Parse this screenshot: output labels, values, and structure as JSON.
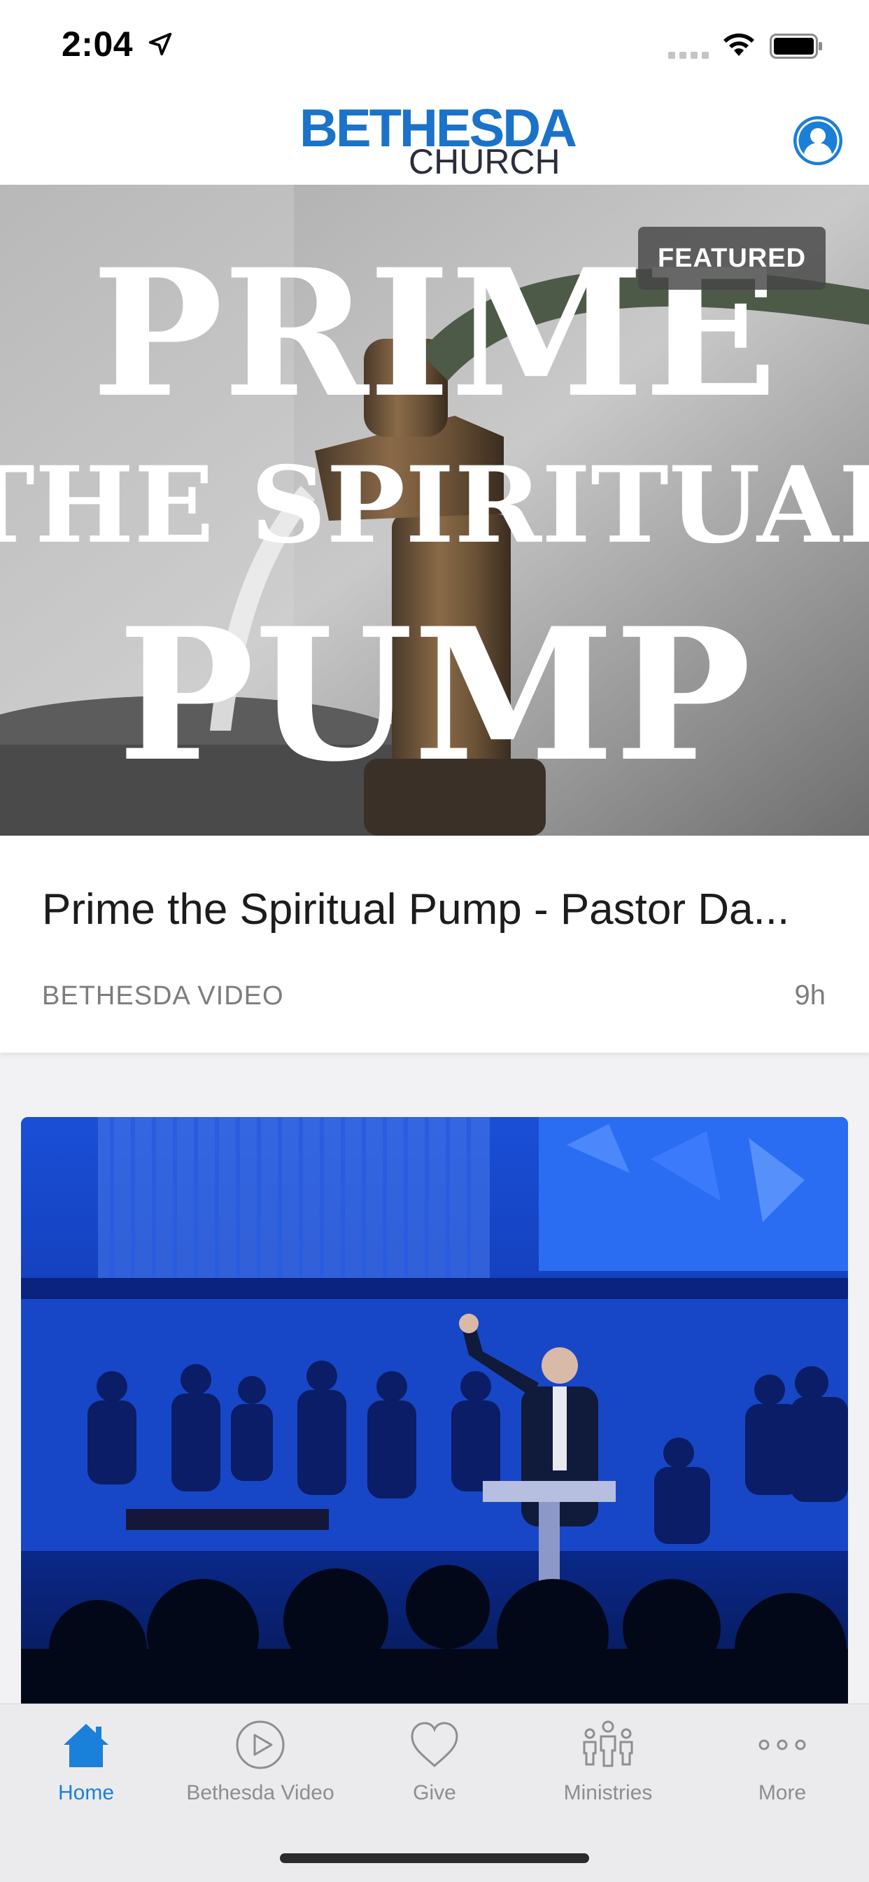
{
  "status_bar": {
    "time": "2:04",
    "icons": [
      "location-arrow-icon",
      "cellular-signal-icon",
      "wifi-icon",
      "battery-icon"
    ]
  },
  "header": {
    "logo_line1": "BETHESDA",
    "logo_line2": "CHURCH",
    "profile_icon": "user-profile-icon",
    "brand_color": "#1a73c8"
  },
  "featured": {
    "badge": "FEATURED",
    "image_text": [
      "PRIME",
      "THE SPIRITUAL",
      "PUMP"
    ],
    "title": "Prime the Spiritual Pump - Pastor Da...",
    "source": "BETHESDA VIDEO",
    "age": "9h"
  },
  "tabs": [
    {
      "label": "Home",
      "icon": "home-icon",
      "active": true
    },
    {
      "label": "Bethesda Video",
      "icon": "play-circle-icon",
      "active": false
    },
    {
      "label": "Give",
      "icon": "heart-icon",
      "active": false
    },
    {
      "label": "Ministries",
      "icon": "people-group-icon",
      "active": false
    },
    {
      "label": "More",
      "icon": "more-dots-icon",
      "active": false
    }
  ],
  "colors": {
    "accent": "#1a80d9",
    "inactive": "#8d8d92",
    "tab_bar_bg": "#ebebed"
  }
}
